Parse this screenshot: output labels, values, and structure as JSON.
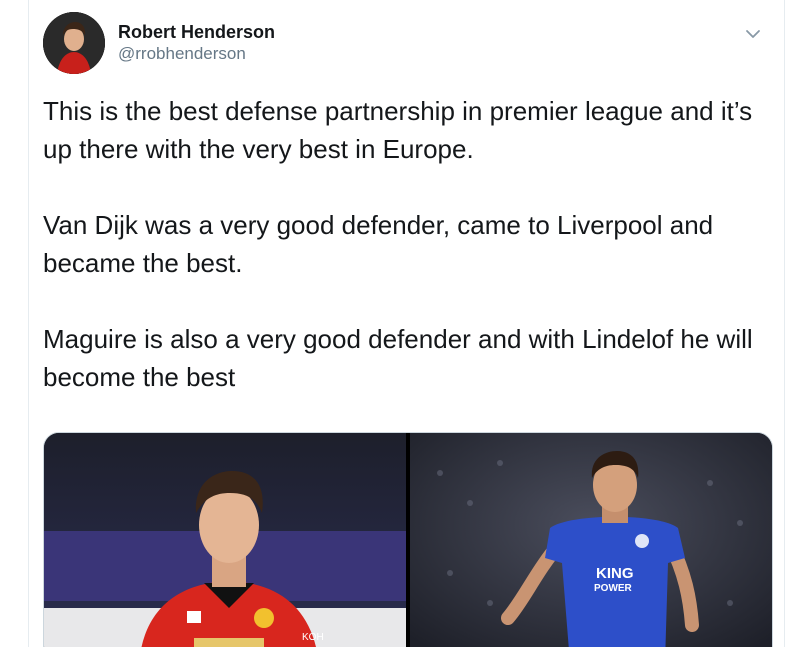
{
  "tweet": {
    "author": {
      "display_name": "Robert Henderson",
      "handle": "@rrobhenderson"
    },
    "paragraphs": [
      "This is the best defense partnership in premier league and it’s up there with the very best in Europe.",
      "Van Dijk was a very good defender, came to Liverpool and became the best.",
      "Maguire is also a very good defender and with Lindelof he will become the best"
    ],
    "media": {
      "left_photo": {
        "icon": "footballer-red-kit-photo",
        "kit_color": "#d8261e"
      },
      "right_photo": {
        "icon": "footballer-blue-kit-photo",
        "kit_color": "#2d4fc9",
        "shirt_sponsor": "KING POWER"
      }
    }
  },
  "colors": {
    "text_primary": "#14171a",
    "text_secondary": "#657786",
    "border": "#e6ecf0"
  }
}
